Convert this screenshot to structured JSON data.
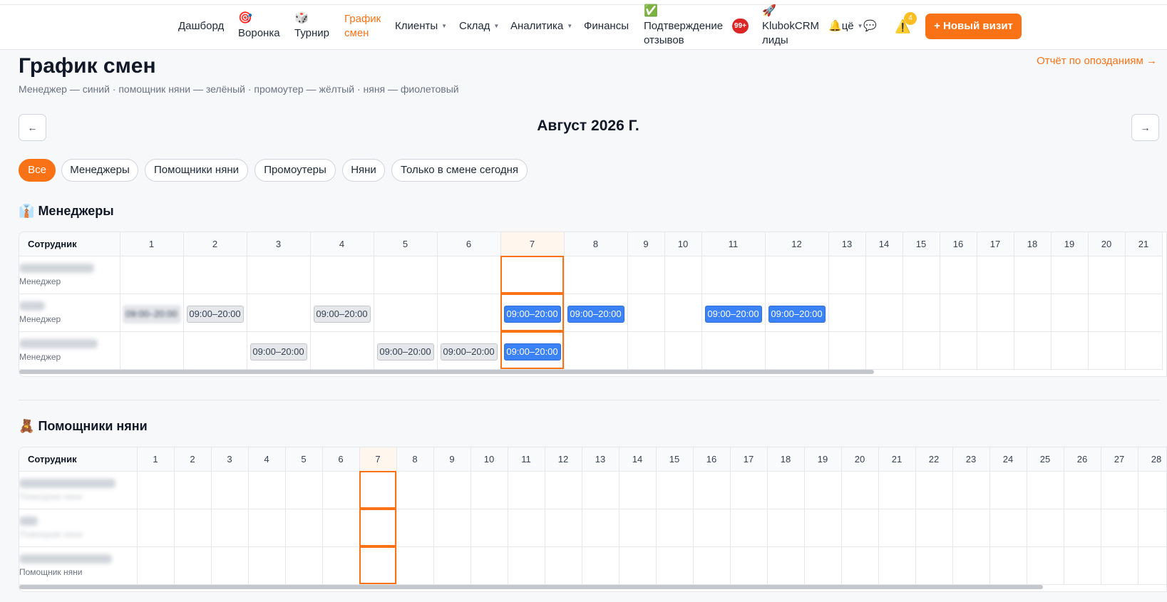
{
  "nav": {
    "dashboard": "Дашборд",
    "funnel": "Воронка",
    "tournament": "Турнир",
    "schedule_line1": "График",
    "schedule_line2": "смен",
    "clients": "Клиенты",
    "warehouse": "Склад",
    "analytics": "Аналитика",
    "finance": "Финансы",
    "reviews_line1": "Подтверждение",
    "reviews_line2": "отзывов",
    "reviews_badge": "99+",
    "crm_line1": "KlubokCRM",
    "crm_line2": "лиды",
    "user_short": "цё",
    "alerts_count": "4",
    "new_visit": "+ Новый визит",
    "icons": {
      "funnel": "target-icon",
      "tournament": "dice-icon",
      "reviews": "check-icon",
      "crm": "rocket-icon",
      "bell": "bell-icon",
      "chat": "chat-icon",
      "alert": "warning-icon"
    }
  },
  "page": {
    "title": "График смен",
    "subtitle": "Менеджер — синий · помощник няни — зелёный · промоутер — жёлтый · няня — фиолетовый",
    "report_link": "Отчёт по опозданиям →",
    "prev": "←",
    "next": "→",
    "month": "Август 2026 Г."
  },
  "filters": [
    "Все",
    "Менеджеры",
    "Помощники няни",
    "Промоутеры",
    "Няни",
    "Только в смене сегодня"
  ],
  "active_filter": 0,
  "today": 7,
  "colors": {
    "accent": "#f97316",
    "manager": "#3b82f6",
    "past_shift": "#e5e7eb"
  },
  "employee_header": "Сотрудник",
  "sections": [
    {
      "icon": "👔",
      "title": "Менеджеры",
      "days": 21,
      "rows": [
        {
          "name_blur": true,
          "role": "Менеджер",
          "role_blur": false,
          "shifts": {}
        },
        {
          "name_blur": true,
          "role": "Менеджер",
          "role_blur": false,
          "shifts": {
            "1": [
              "09:00–20:00",
              "gray",
              true
            ],
            "2": [
              "09:00–20:00",
              "gray"
            ],
            "4": [
              "09:00–20:00",
              "gray"
            ],
            "7": [
              "09:00–20:00",
              "blue"
            ],
            "8": [
              "09:00–20:00",
              "blue"
            ],
            "11": [
              "09:00–20:00",
              "blue"
            ],
            "12": [
              "09:00–20:00",
              "blue"
            ]
          }
        },
        {
          "name_blur": true,
          "role": "Менеджер",
          "role_blur": false,
          "shifts": {
            "3": [
              "09:00–20:00",
              "gray"
            ],
            "5": [
              "09:00–20:00",
              "gray"
            ],
            "6": [
              "09:00–20:00",
              "gray"
            ],
            "7": [
              "09:00–20:00",
              "blue"
            ]
          }
        }
      ]
    },
    {
      "icon": "🧸",
      "title": "Помощники няни",
      "days": 28,
      "rows": [
        {
          "name_blur": true,
          "role": "Помощник няни",
          "role_blur": true,
          "shifts": {}
        },
        {
          "name_blur": true,
          "role": "Помощник няни",
          "role_blur": true,
          "shifts": {}
        },
        {
          "name_blur": true,
          "role": "Помощник няни",
          "role_blur": false,
          "shifts": {}
        }
      ]
    }
  ]
}
